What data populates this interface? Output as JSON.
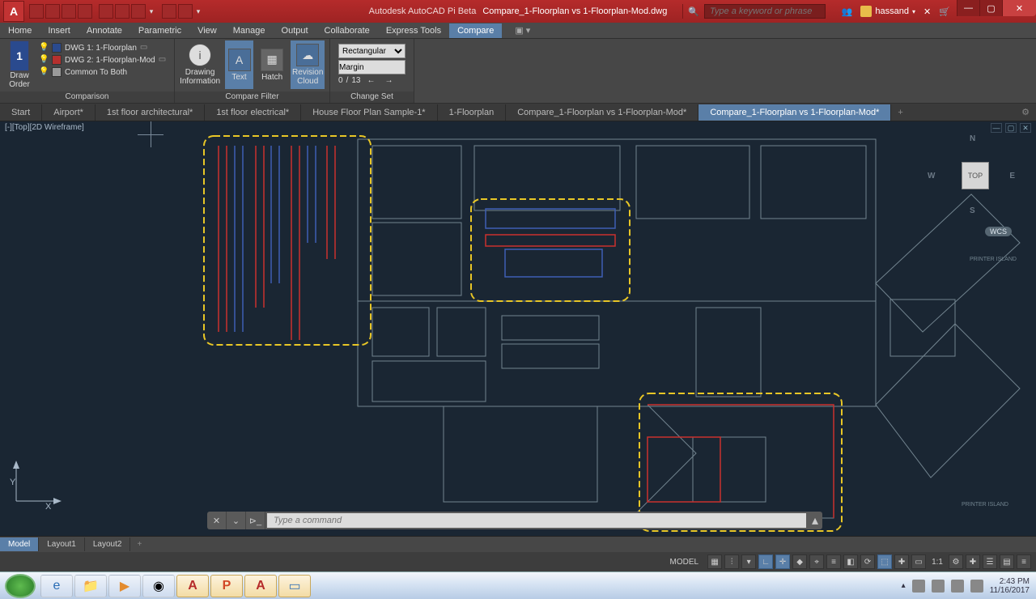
{
  "title": {
    "app": "Autodesk AutoCAD Pi Beta",
    "file": "Compare_1-Floorplan vs 1-Floorplan-Mod.dwg"
  },
  "search_placeholder": "Type a keyword or phrase",
  "user": "hassand",
  "menu": {
    "items": [
      "Home",
      "Insert",
      "Annotate",
      "Parametric",
      "View",
      "Manage",
      "Output",
      "Collaborate",
      "Express Tools",
      "Compare"
    ],
    "active": 9
  },
  "ribbon": {
    "comparison": {
      "title": "Comparison",
      "draw_order": "Draw\nOrder",
      "order_num": "1",
      "rows": [
        {
          "swatch": "#2a4a8e",
          "label": "DWG 1:  1-Floorplan"
        },
        {
          "swatch": "#b5302e",
          "label": "DWG 2:  1-Floorplan-Mod"
        },
        {
          "swatch": "#9a9a9a",
          "label": "Common To Both"
        }
      ]
    },
    "filter": {
      "title": "Compare Filter",
      "info": "Drawing\nInformation",
      "text": "Text",
      "hatch": "Hatch",
      "cloud": "Revision\nCloud"
    },
    "changeset": {
      "title": "Change Set",
      "shape": "Rectangular",
      "margin": "Margin",
      "index": "0",
      "total": "13"
    }
  },
  "doctabs": {
    "items": [
      "Start",
      "Airport*",
      "1st floor architectural*",
      "1st floor electrical*",
      "House Floor Plan Sample-1*",
      "1-Floorplan",
      "Compare_1-Floorplan vs 1-Floorplan-Mod*",
      "Compare_1-Floorplan vs 1-Floorplan-Mod*"
    ],
    "active": 7
  },
  "viewport": {
    "label": "[-][Top][2D Wireframe]",
    "cube": {
      "top": "TOP",
      "n": "N",
      "s": "S",
      "e": "E",
      "w": "W"
    },
    "wcs": "WCS",
    "printer_island": "PRINTER  ISLAND"
  },
  "ucs": {
    "x": "X",
    "y": "Y"
  },
  "cmd_placeholder": "Type a command",
  "modeltabs": {
    "items": [
      "Model",
      "Layout1",
      "Layout2"
    ],
    "active": 0
  },
  "status": {
    "model": "MODEL",
    "scale": "1:1"
  },
  "tray": {
    "time": "2:43 PM",
    "date": "11/16/2017"
  }
}
